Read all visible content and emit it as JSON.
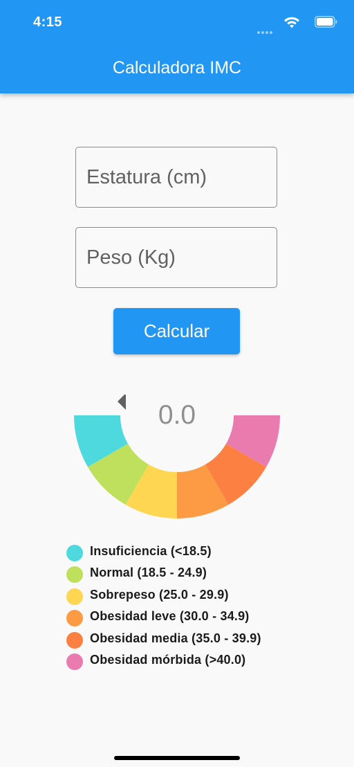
{
  "status_bar": {
    "time": "4:15"
  },
  "app_bar": {
    "title": "Calculadora IMC"
  },
  "form": {
    "height_placeholder": "Estatura (cm)",
    "height_value": "",
    "weight_placeholder": "Peso (Kg)",
    "weight_value": "",
    "calculate_label": "Calcular"
  },
  "gauge": {
    "value_text": "0.0",
    "value": 0.0,
    "segments": [
      {
        "label": "Insuficiencia (<18.5)",
        "color": "#4dd9de"
      },
      {
        "label": "Normal (18.5 - 24.9)",
        "color": "#bfe05c"
      },
      {
        "label": "Sobrepeso (25.0 - 29.9)",
        "color": "#fed652"
      },
      {
        "label": "Obesidad leve (30.0 - 34.9)",
        "color": "#fd9b44"
      },
      {
        "label": "Obesidad media (35.0 - 39.9)",
        "color": "#fc8041"
      },
      {
        "label": "Obesidad mórbida (>40.0)",
        "color": "#e97bae"
      }
    ],
    "indicator_color": "#616161"
  },
  "theme": {
    "primary": "#2196f3",
    "background": "#f9f9f9"
  }
}
